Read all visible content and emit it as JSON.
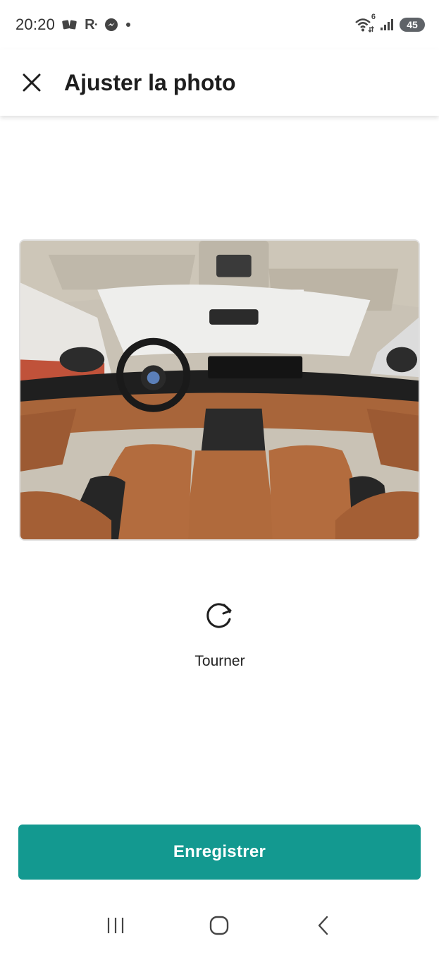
{
  "status_bar": {
    "time": "20:20",
    "notification_icons": [
      "cards-icon",
      "r-app-icon",
      "messenger-icon",
      "dot-icon"
    ],
    "r_app_label": "R",
    "wifi_badge": "6",
    "battery_level": "45"
  },
  "app_bar": {
    "title": "Ajuster la photo",
    "close_icon": "close-icon"
  },
  "photo": {
    "description_icon": "car-interior-photo"
  },
  "rotate": {
    "label": "Tourner",
    "icon": "rotate-clockwise-icon"
  },
  "save": {
    "label": "Enregistrer",
    "color": "#139990"
  },
  "nav_bar": {
    "items": [
      "recents-icon",
      "home-icon",
      "back-icon"
    ]
  }
}
